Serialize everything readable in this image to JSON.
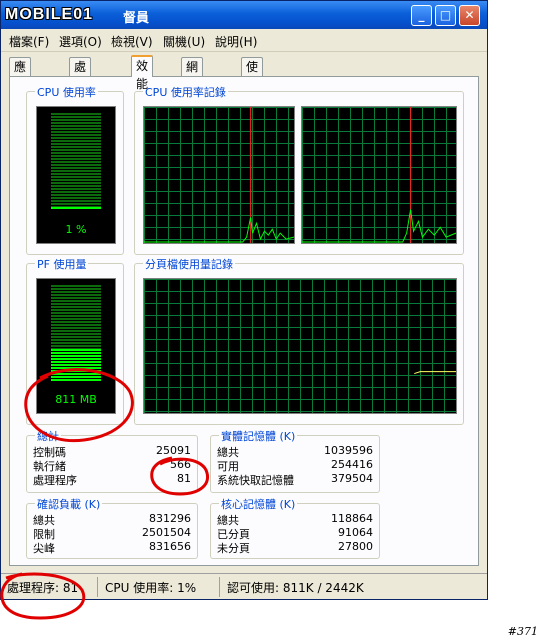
{
  "window": {
    "title_logo": "MOBILE01",
    "title_rest": "督員",
    "buttons": {
      "minimize": "_",
      "maximize": "□",
      "close": "✕"
    }
  },
  "menu": [
    {
      "label": "檔案(F)"
    },
    {
      "label": "選項(O)"
    },
    {
      "label": "檢視(V)"
    },
    {
      "label": "關機(U)"
    },
    {
      "label": "說明(H)"
    }
  ],
  "tabs": [
    {
      "label": "應用程式"
    },
    {
      "label": "處理程序"
    },
    {
      "label": "效能"
    },
    {
      "label": "網路功能"
    },
    {
      "label": "使用者"
    }
  ],
  "active_tab": "效能",
  "cpu_usage": {
    "label": "CPU 使用率",
    "value": "1 %",
    "level_percent": 1
  },
  "cpu_history": {
    "label": "CPU 使用率記錄"
  },
  "pf_usage": {
    "label": "PF 使用量",
    "value": "811 MB",
    "level_percent": 33
  },
  "pf_history": {
    "label": "分頁檔使用量記錄"
  },
  "totals": {
    "label": "總計",
    "rows": [
      {
        "key": "控制碼",
        "value": "25091"
      },
      {
        "key": "執行緒",
        "value": "566"
      },
      {
        "key": "處理程序",
        "value": "81"
      }
    ]
  },
  "physical_memory": {
    "label": "實體記憶體 (K)",
    "rows": [
      {
        "key": "總共",
        "value": "1039596"
      },
      {
        "key": "可用",
        "value": "254416"
      },
      {
        "key": "系統快取記憶體",
        "value": "379504"
      }
    ]
  },
  "commit_charge": {
    "label": "確認負載 (K)",
    "rows": [
      {
        "key": "總共",
        "value": "831296"
      },
      {
        "key": "限制",
        "value": "2501504"
      },
      {
        "key": "尖峰",
        "value": "831656"
      }
    ]
  },
  "kernel_memory": {
    "label": "核心記憶體 (K)",
    "rows": [
      {
        "key": "總共",
        "value": "118864"
      },
      {
        "key": "已分頁",
        "value": "91064"
      },
      {
        "key": "未分頁",
        "value": "27800"
      }
    ]
  },
  "status": {
    "processes": "處理程序: 81",
    "cpu": "CPU 使用率: 1%",
    "commit": "認可使用: 811K / 2442K"
  },
  "watermark": "#371",
  "colors": {
    "graph_line": "#00ff00",
    "grid": "#0a7a3a",
    "spike": "#ff2020",
    "annotation": "#e00000"
  }
}
